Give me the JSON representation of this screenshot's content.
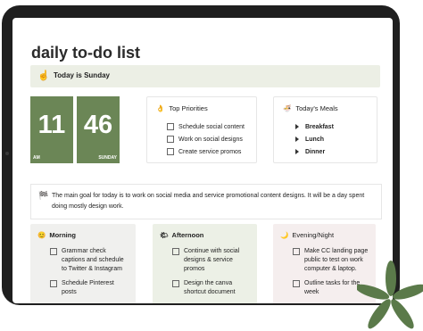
{
  "page_title": "daily to-do list",
  "today": {
    "icon": "pointing-finger-icon",
    "text": "Today is Sunday"
  },
  "clock": {
    "hour": "11",
    "minute": "46",
    "ampm": "AM",
    "day": "SUNDAY"
  },
  "priorities": {
    "icon": "thumbs-up-icon",
    "title": "Top Priorities",
    "items": [
      "Schedule social content",
      "Work on social designs",
      "Create service promos"
    ]
  },
  "meals": {
    "icon": "bowl-icon",
    "title": "Today's Meals",
    "items": [
      "Breakfast",
      "Lunch",
      "Dinner"
    ]
  },
  "goal": {
    "icon": "flag-icon",
    "text": "The main goal for today is to work on social media and service promotional content designs. It will be a day spent doing mostly design work."
  },
  "morning": {
    "icon": "sun-face-icon",
    "title": "Morning",
    "items": [
      "Grammar check captions and schedule to Twitter & Instagram",
      "Schedule Pinterest posts"
    ]
  },
  "afternoon": {
    "icon": "sun-icon",
    "title": "Afternoon",
    "items": [
      "Continue with social designs & service promos",
      "Design the canva shortcut document"
    ]
  },
  "evening": {
    "icon": "moon-icon",
    "title": "Evening/Night",
    "items": [
      "Make CC landing page public to test on work computer & laptop.",
      "Outline tasks for the week"
    ]
  },
  "colors": {
    "clock_green": "#6b8656",
    "today_bg": "#ecefe5",
    "morning_bg": "#f0f0ee",
    "afternoon_bg": "#ecf0e6",
    "evening_bg": "#f5eeee",
    "leaf_green": "#5b7a4a",
    "device": "#1f1f1f"
  }
}
